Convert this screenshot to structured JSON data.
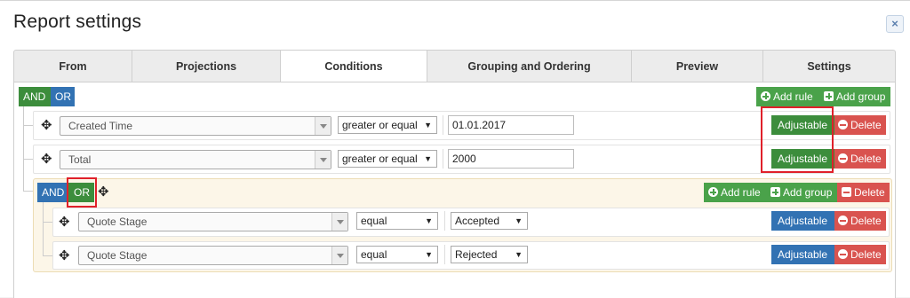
{
  "dialog": {
    "title": "Report settings",
    "close_label": "×"
  },
  "tabs": [
    {
      "label": "From"
    },
    {
      "label": "Projections"
    },
    {
      "label": "Conditions"
    },
    {
      "label": "Grouping and Ordering"
    },
    {
      "label": "Preview"
    },
    {
      "label": "Settings"
    }
  ],
  "active_tab": "Conditions",
  "root_group": {
    "and_label": "AND",
    "or_label": "OR",
    "add_rule": "Add rule",
    "add_group": "Add group",
    "rules": [
      {
        "field": "Created Time",
        "operator": "greater or equal",
        "value": "01.01.2017",
        "adjustable": "Adjustable",
        "delete": "Delete"
      },
      {
        "field": "Total",
        "operator": "greater or equal",
        "value": "2000",
        "adjustable": "Adjustable",
        "delete": "Delete"
      }
    ]
  },
  "sub_group": {
    "and_label": "AND",
    "or_label": "OR",
    "add_rule": "Add rule",
    "add_group": "Add group",
    "delete": "Delete",
    "rules": [
      {
        "field": "Quote Stage",
        "operator": "equal",
        "value": "Accepted",
        "adjustable": "Adjustable",
        "delete": "Delete"
      },
      {
        "field": "Quote Stage",
        "operator": "equal",
        "value": "Rejected",
        "adjustable": "Adjustable",
        "delete": "Delete"
      }
    ]
  },
  "colors": {
    "green": "#4aa24a",
    "dark_green": "#3c8d3c",
    "blue": "#3272b3",
    "red": "#d9534f",
    "highlight": "#e0202a"
  },
  "icons": {
    "move": "move-arrows-icon",
    "add": "plus-circle-icon",
    "add_group": "plus-square-icon",
    "delete": "minus-circle-icon",
    "close": "close-icon"
  }
}
